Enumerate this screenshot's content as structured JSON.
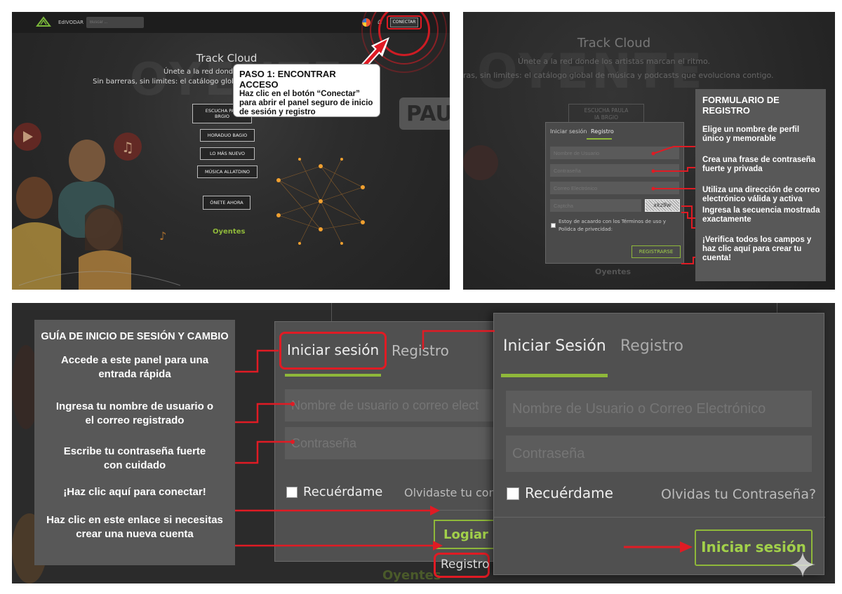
{
  "panel1": {
    "nav": {
      "brand": "EdIVODAR",
      "search_placeholder": "Buscar ...",
      "connect_label": "CONECTAR"
    },
    "hero": {
      "title": "Track Cloud",
      "line1": "Únete a la red donde los ar",
      "line2": "Sin barreras, sin limites: el catálogo global de m"
    },
    "buttons": [
      "ESCUCHA PA... BRGIO",
      "HORADUO BAGIO",
      "LO MÁS NUEVO",
      "MÚSICA ALLATDINO",
      "ÓNETE AHORA"
    ],
    "footer_label": "Oyentes",
    "callout": {
      "title": "PASO 1: ENCONTRAR ACCESO",
      "body": "Haz clic en el botón “Conectar” para abrir el panel seguro de inicio de sesión y registro"
    },
    "bg_words": [
      "OYENTE",
      "PAU"
    ]
  },
  "panel2": {
    "hero": {
      "title": "Track Cloud",
      "line1": "Únete a la red donde los artistas marcan el ritmo.",
      "line2": "ras, sin limites: el catálogo global de música y podcasts que evoluciona contigo."
    },
    "bg_words": [
      "OYENTE"
    ],
    "bg_button": "ESCUCHA PAULA IA BRGIO",
    "form": {
      "tabs": [
        "Iniciar sesión",
        "Registro"
      ],
      "fields": [
        "Nombre de Usuario",
        "Contraseña",
        "Correo Electrónico",
        "Captcha"
      ],
      "captcha_text": "xkz9w",
      "terms": "Estoy de acaardo con los Términos de uso y Polidca de privecidad:",
      "submit": "REGISTRARSE"
    },
    "footer_label": "Oyentes",
    "callout": {
      "title": "FORMULARIO DE REGISTRO",
      "items": [
        "Elige un nombre de perfil único y memorable",
        "Crea una frase de contraseña fuerte y privada",
        "Utiliza una dirección de correo electrónico válida y activa",
        "Ingresa la secuencia mostrada exactamente",
        "¡Verifica todos los campos y haz clic aquí para crear tu cuenta!"
      ]
    }
  },
  "panel3": {
    "guide": {
      "title": "GUÍA DE INICIO DE SESIÓN Y CAMBIO",
      "items": [
        "Accede a este panel para una entrada rápida",
        "Ingresa tu nombre de usuario o el correo registrado",
        "Escribe tu contraseña fuerte con cuidado",
        "¡Haz clic aquí para conectar!",
        "Haz clic en este enlace si necesitas crear una nueva cuenta"
      ]
    },
    "form_back": {
      "tab_login": "Iniciar sesión",
      "tab_register": "Registro",
      "user_placeholder": "Nombre de usuario o correo elect",
      "password_placeholder": "Contraseña",
      "remember": "Recuérdame",
      "forgot": "Olvidaste tu con",
      "submit": "Logiar se",
      "register_link": "Registro"
    },
    "form_front": {
      "tab_login": "Iniciar Sesión",
      "tab_register": "Registro",
      "user_placeholder": "Nombre de Usuario o Correo Electrónico",
      "password_placeholder": "Contraseña",
      "remember": "Recuérdame",
      "forgot": "Olvidas tu Contraseña?",
      "submit": "Iniciar sesión"
    },
    "footer_label": "Oyentes"
  },
  "colors": {
    "accent_green": "#8fb83a",
    "highlight_red": "#e01b24",
    "panel_bg": "#2b2b2b"
  }
}
